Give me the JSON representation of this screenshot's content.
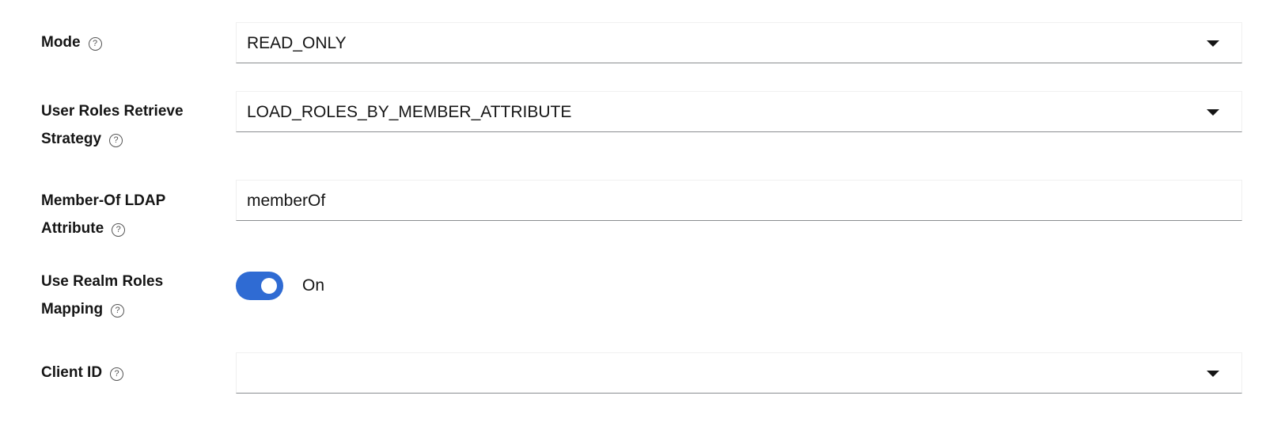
{
  "fields": {
    "mode": {
      "label": "Mode",
      "value": "READ_ONLY"
    },
    "strategy": {
      "label_line1": "User Roles Retrieve",
      "label_line2": "Strategy",
      "value": "LOAD_ROLES_BY_MEMBER_ATTRIBUTE"
    },
    "member_of": {
      "label_line1": "Member-Of LDAP",
      "label_line2": "Attribute",
      "value": "memberOf"
    },
    "realm_roles": {
      "label_line1": "Use Realm Roles",
      "label_line2": "Mapping",
      "state": "On",
      "enabled": true
    },
    "client_id": {
      "label": "Client ID",
      "value": ""
    }
  },
  "help_icon_glyph": "?",
  "colors": {
    "toggle_on": "#2f6bd3",
    "label_text": "#151515",
    "border_bottom": "#8a8d90"
  }
}
